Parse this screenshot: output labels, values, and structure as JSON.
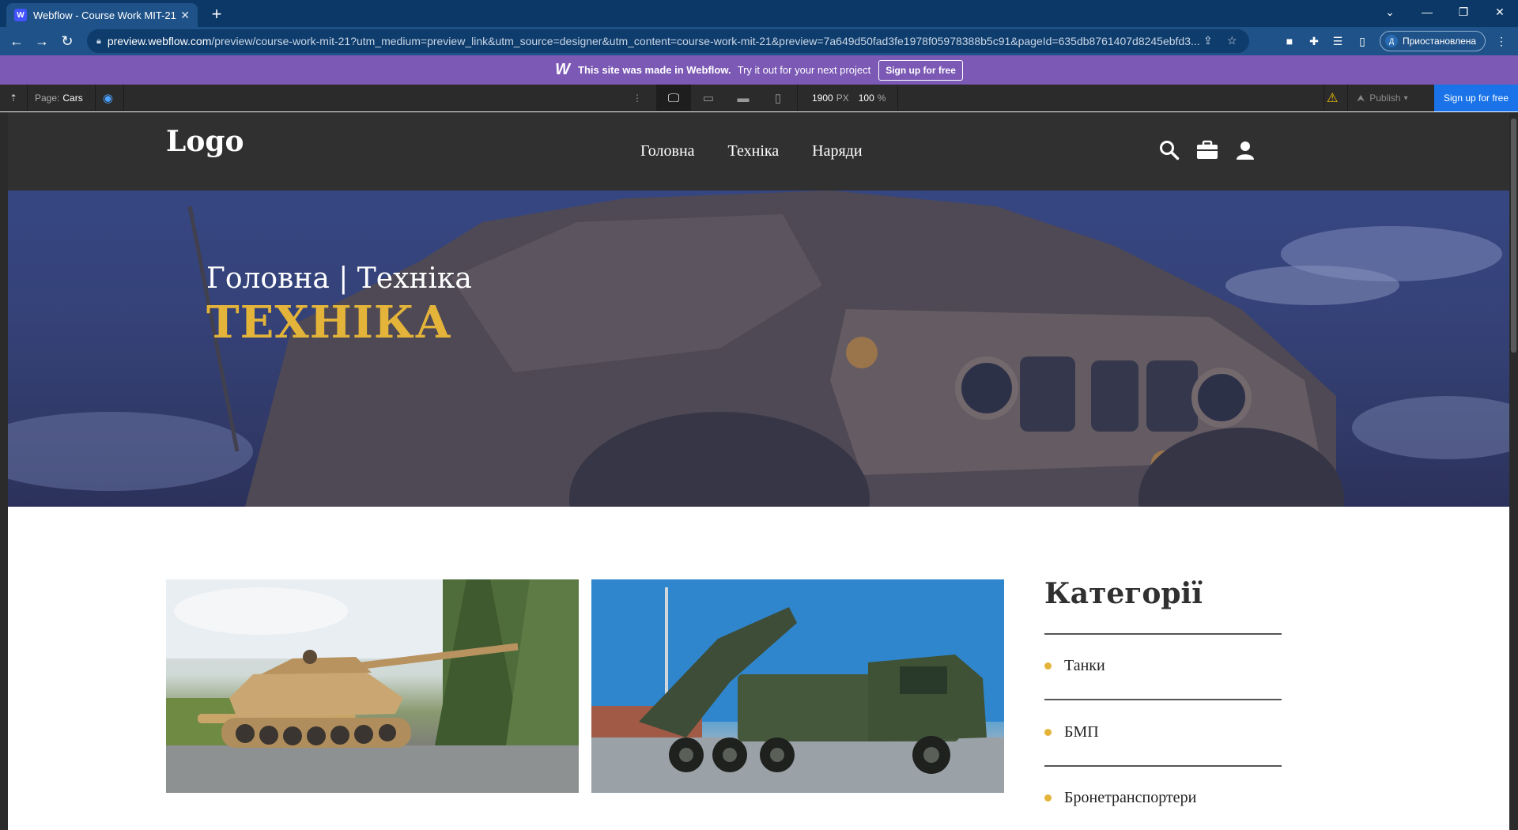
{
  "browser": {
    "tab_title": "Webflow - Course Work MIT-21",
    "url_host": "preview.webflow.com",
    "url_path": "/preview/course-work-mit-21?utm_medium=preview_link&utm_source=designer&utm_content=course-work-mit-21&preview=7a649d50fad3fe1978f05978388b5c91&pageId=635db8761407d8245ebfd3...",
    "profile_initial": "Д",
    "profile_label": "Приостановлена"
  },
  "webflow_banner": {
    "logo": "W",
    "made_text": "This site was made in Webflow.",
    "cta_text": "Try it out for your next project",
    "signup_label": "Sign up for free"
  },
  "webflow_toolbar": {
    "page_prefix": "Page:",
    "page_name": "Cars",
    "width_value": "1900",
    "width_unit": "PX",
    "zoom_value": "100",
    "zoom_unit": "%",
    "publish_label": "Publish",
    "signup_label": "Sign up for free"
  },
  "site": {
    "logo": "Logo",
    "nav": [
      "Головна",
      "Техніка",
      "Наряди"
    ],
    "hero": {
      "breadcrumb": "Головна | Техніка",
      "title": "ТЕХНІКА"
    },
    "categories": {
      "title": "Категорії",
      "items": [
        "Танки",
        "БМП",
        "Бронетранспортери"
      ]
    }
  },
  "colors": {
    "accent": "#e4b43a",
    "header_bg": "#303030",
    "webflow_purple": "#7b59b5",
    "chrome_blue": "#1f5288"
  }
}
